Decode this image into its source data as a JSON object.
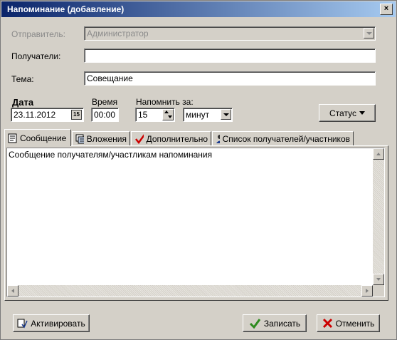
{
  "window": {
    "title": "Напоминание (добавление)",
    "close_glyph": "×"
  },
  "form": {
    "sender_label": "Отправитель:",
    "sender_value": "Администратор",
    "recipients_label": "Получатели:",
    "recipients_value": "",
    "subject_label": "Тема:",
    "subject_value": "Совещание",
    "date_label": "Дата",
    "date_value": "23.11.2012",
    "calendar_glyph": "15",
    "time_label": "Время",
    "time_value": "00:00",
    "remind_label": "Напомнить за:",
    "remind_value": "15",
    "remind_unit": "минут",
    "status_button": "Статус"
  },
  "tabs": [
    {
      "label": "Сообщение",
      "icon": "document-icon"
    },
    {
      "label": "Вложения",
      "icon": "attachments-icon"
    },
    {
      "label": "Дополнительно",
      "icon": "checkmark-icon"
    },
    {
      "label": "Список получателей/участников",
      "icon": "people-icon"
    }
  ],
  "message": {
    "text": "Сообщение получателям/участликам напоминания"
  },
  "footer": {
    "activate": "Активировать",
    "save": "Записать",
    "cancel": "Отменить"
  },
  "colors": {
    "titlebar_start": "#0a246a",
    "titlebar_end": "#a6caf0",
    "face": "#d4d0c8",
    "check_green": "#2e8b1f",
    "cancel_red": "#cc0000"
  }
}
